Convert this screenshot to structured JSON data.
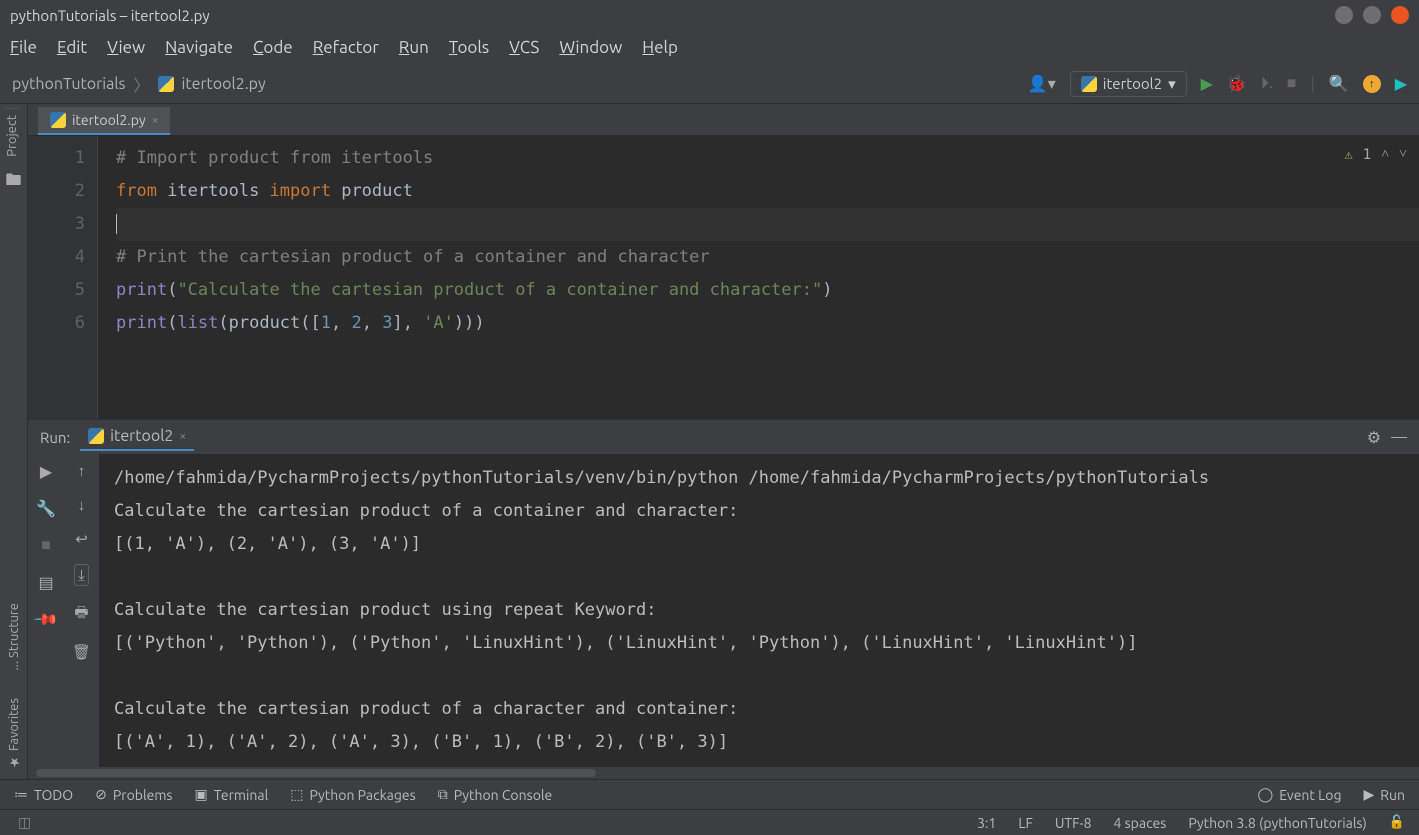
{
  "window": {
    "title": "pythonTutorials – itertool2.py"
  },
  "menu": {
    "items": [
      "File",
      "Edit",
      "View",
      "Navigate",
      "Code",
      "Refactor",
      "Run",
      "Tools",
      "VCS",
      "Window",
      "Help"
    ]
  },
  "breadcrumb": {
    "project": "pythonTutorials",
    "file": "itertool2.py"
  },
  "run_config": {
    "name": "itertool2"
  },
  "editor": {
    "tab": "itertool2.py",
    "warnings": "1",
    "lines": [
      {
        "n": "1",
        "tokens": [
          {
            "t": "# Import product from itertools",
            "c": "c-comment"
          }
        ]
      },
      {
        "n": "2",
        "tokens": [
          {
            "t": "from ",
            "c": "c-keyword"
          },
          {
            "t": "itertools ",
            "c": "c-ident"
          },
          {
            "t": "import ",
            "c": "c-keyword"
          },
          {
            "t": "product",
            "c": "c-ident"
          }
        ]
      },
      {
        "n": "3",
        "tokens": [],
        "current": true
      },
      {
        "n": "4",
        "tokens": [
          {
            "t": "# Print the cartesian product of a container and character",
            "c": "c-comment"
          }
        ]
      },
      {
        "n": "5",
        "tokens": [
          {
            "t": "print",
            "c": "c-builtin"
          },
          {
            "t": "(",
            "c": "c-ident"
          },
          {
            "t": "\"Calculate the cartesian product of a container and character:\"",
            "c": "c-string"
          },
          {
            "t": ")",
            "c": "c-ident"
          }
        ]
      },
      {
        "n": "6",
        "tokens": [
          {
            "t": "print",
            "c": "c-builtin"
          },
          {
            "t": "(",
            "c": "c-ident"
          },
          {
            "t": "list",
            "c": "c-builtin"
          },
          {
            "t": "(product([",
            "c": "c-ident"
          },
          {
            "t": "1",
            "c": "c-num"
          },
          {
            "t": ", ",
            "c": "c-ident"
          },
          {
            "t": "2",
            "c": "c-num"
          },
          {
            "t": ", ",
            "c": "c-ident"
          },
          {
            "t": "3",
            "c": "c-num"
          },
          {
            "t": "], ",
            "c": "c-ident"
          },
          {
            "t": "'A'",
            "c": "c-string"
          },
          {
            "t": ")))",
            "c": "c-ident"
          }
        ]
      }
    ]
  },
  "run_panel": {
    "label": "Run:",
    "tab": "itertool2",
    "output": "/home/fahmida/PycharmProjects/pythonTutorials/venv/bin/python /home/fahmida/PycharmProjects/pythonTutorials\nCalculate the cartesian product of a container and character:\n[(1, 'A'), (2, 'A'), (3, 'A')]\n\nCalculate the cartesian product using repeat Keyword:\n[('Python', 'Python'), ('Python', 'LinuxHint'), ('LinuxHint', 'Python'), ('LinuxHint', 'LinuxHint')]\n\nCalculate the cartesian product of a character and container:\n[('A', 1), ('A', 2), ('A', 3), ('B', 1), ('B', 2), ('B', 3)]"
  },
  "sidebars": {
    "left_top": "Project",
    "structure": "Structure",
    "favorites": "Favorites"
  },
  "bottom": {
    "items": [
      "TODO",
      "Problems",
      "Terminal",
      "Python Packages",
      "Python Console"
    ],
    "event_log": "Event Log",
    "run": "Run"
  },
  "status": {
    "pos": "3:1",
    "eol": "LF",
    "enc": "UTF-8",
    "indent": "4 spaces",
    "interpreter": "Python 3.8 (pythonTutorials)"
  }
}
